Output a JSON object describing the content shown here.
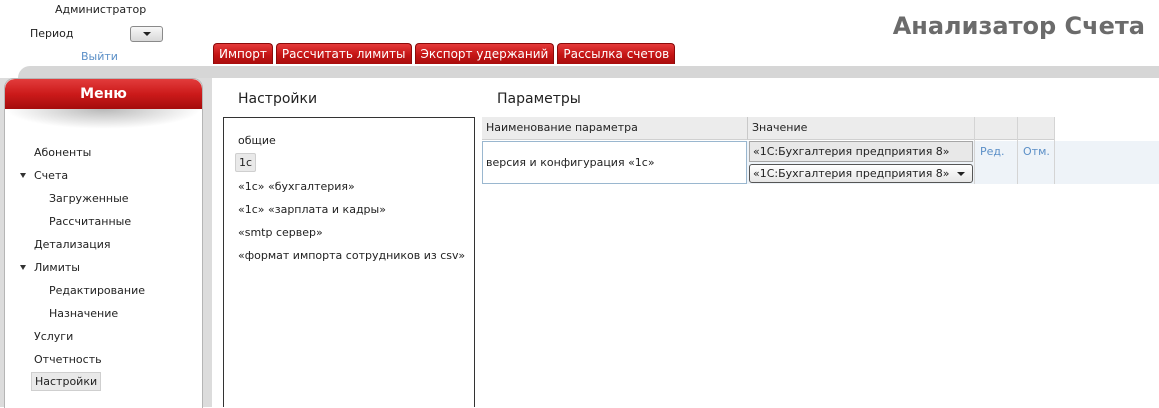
{
  "header": {
    "user_name": "Администратор",
    "period_label": "Период",
    "logout_label": "Выйти",
    "app_title": "Анализатор Счета"
  },
  "tabs": [
    {
      "label": "Импорт"
    },
    {
      "label": "Рассчитать лимиты"
    },
    {
      "label": "Экспорт удержаний"
    },
    {
      "label": "Рассылка счетов"
    }
  ],
  "menu": {
    "title": "Меню",
    "items": [
      {
        "label": "Абоненты"
      },
      {
        "label": "Счета"
      },
      {
        "label": "Загруженные"
      },
      {
        "label": "Рассчитанные"
      },
      {
        "label": "Детализация"
      },
      {
        "label": "Лимиты"
      },
      {
        "label": "Редактирование"
      },
      {
        "label": "Назначение"
      },
      {
        "label": "Услуги"
      },
      {
        "label": "Отчетность"
      },
      {
        "label": "Настройки"
      }
    ]
  },
  "settings": {
    "title": "Настройки",
    "items": [
      {
        "label": "общие"
      },
      {
        "label": "1с"
      },
      {
        "label": "«1с» «бухгалтерия»"
      },
      {
        "label": "«1с» «зарплата и кадры»"
      },
      {
        "label": "«smtp сервер»"
      },
      {
        "label": "«формат импорта сотрудников из csv»"
      }
    ]
  },
  "parameters": {
    "title": "Параметры",
    "columns": [
      "Наименование параметра",
      "Значение"
    ],
    "rows": [
      {
        "name": "версия и конфигурация «1с»",
        "value": "«1С:Бухгалтерия предприятия 8»",
        "selected_value": "«1С:Бухгалтерия предприятия 8»",
        "edit_label": "Ред.",
        "cancel_label": "Отм."
      }
    ]
  },
  "colors": {
    "accent_red": "#cc1a1a",
    "link_blue": "#5b8fc7",
    "title_gray": "#6b6b6b"
  }
}
